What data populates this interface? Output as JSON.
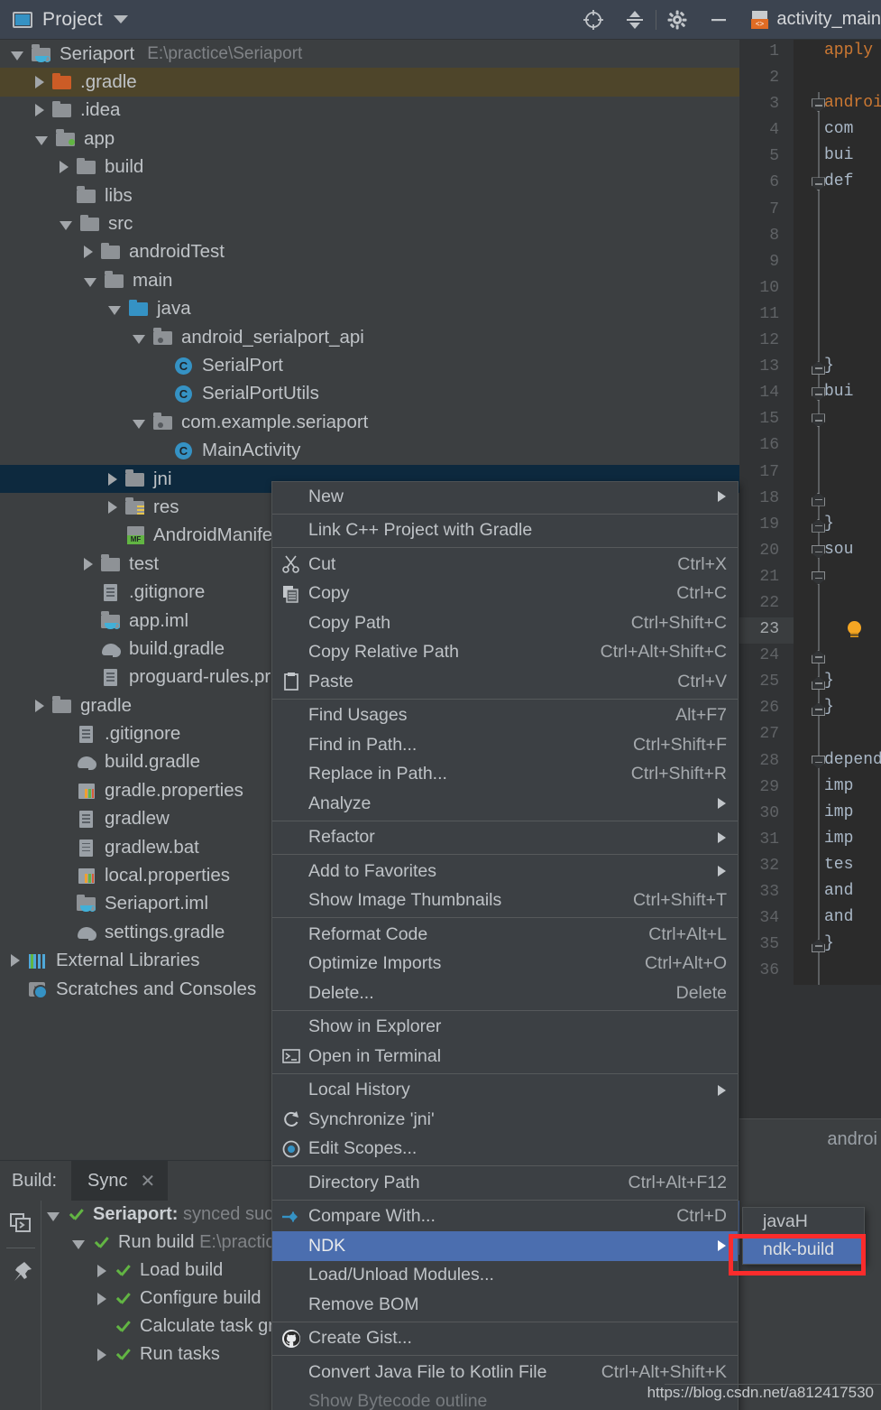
{
  "project_panel": {
    "header": {
      "title": "Project",
      "icon": "project-window-icon",
      "caret_icon": "chevron-down-icon",
      "tools": [
        {
          "name": "locate-icon",
          "label": "Select Opened File"
        },
        {
          "name": "collapse-all-icon",
          "label": "Collapse All"
        },
        {
          "name": "gear-icon",
          "label": "Settings"
        },
        {
          "name": "minimize-icon",
          "label": "Hide"
        }
      ]
    },
    "tree": [
      {
        "label": "Seriaport",
        "path": "E:\\practice\\Seriaport",
        "indent": 0,
        "arrow": "down",
        "icon": "module-folder-icon",
        "state": "normal"
      },
      {
        "label": ".gradle",
        "indent": 1,
        "arrow": "right",
        "icon": "folder-orange-icon",
        "state": "olive"
      },
      {
        "label": ".idea",
        "indent": 1,
        "arrow": "right",
        "icon": "folder-icon",
        "state": "normal"
      },
      {
        "label": "app",
        "indent": 1,
        "arrow": "down",
        "icon": "folder-module-icon",
        "state": "normal"
      },
      {
        "label": "build",
        "indent": 2,
        "arrow": "right",
        "icon": "folder-icon",
        "state": "normal"
      },
      {
        "label": "libs",
        "indent": 2,
        "arrow": "none",
        "icon": "folder-icon",
        "state": "normal"
      },
      {
        "label": "src",
        "indent": 2,
        "arrow": "down",
        "icon": "folder-icon",
        "state": "normal"
      },
      {
        "label": "androidTest",
        "indent": 3,
        "arrow": "right",
        "icon": "folder-icon",
        "state": "normal"
      },
      {
        "label": "main",
        "indent": 3,
        "arrow": "down",
        "icon": "folder-icon",
        "state": "normal"
      },
      {
        "label": "java",
        "indent": 4,
        "arrow": "down",
        "icon": "folder-blue-icon",
        "state": "normal"
      },
      {
        "label": "android_serialport_api",
        "indent": 5,
        "arrow": "down",
        "icon": "package-icon",
        "state": "normal"
      },
      {
        "label": "SerialPort",
        "indent": 6,
        "arrow": "none",
        "icon": "java-class-icon",
        "state": "normal"
      },
      {
        "label": "SerialPortUtils",
        "indent": 6,
        "arrow": "none",
        "icon": "java-class-icon",
        "state": "normal"
      },
      {
        "label": "com.example.seriaport",
        "indent": 5,
        "arrow": "down",
        "icon": "package-icon",
        "state": "normal"
      },
      {
        "label": "MainActivity",
        "indent": 6,
        "arrow": "none",
        "icon": "java-class-icon",
        "state": "normal"
      },
      {
        "label": "jni",
        "indent": 4,
        "arrow": "right",
        "icon": "folder-icon",
        "state": "selected"
      },
      {
        "label": "res",
        "indent": 4,
        "arrow": "right",
        "icon": "folder-res-icon",
        "state": "normal"
      },
      {
        "label": "AndroidManifest.xml",
        "indent": 4,
        "arrow": "none",
        "icon": "manifest-icon",
        "state": "normal"
      },
      {
        "label": "test",
        "indent": 3,
        "arrow": "right",
        "icon": "folder-icon",
        "state": "normal"
      },
      {
        "label": ".gitignore",
        "indent": 3,
        "arrow": "none",
        "icon": "file-icon",
        "state": "normal"
      },
      {
        "label": "app.iml",
        "indent": 3,
        "arrow": "none",
        "icon": "module-folder-icon",
        "state": "normal"
      },
      {
        "label": "build.gradle",
        "indent": 3,
        "arrow": "none",
        "icon": "gradle-icon",
        "state": "normal"
      },
      {
        "label": "proguard-rules.pro",
        "indent": 3,
        "arrow": "none",
        "icon": "file-icon",
        "state": "normal"
      },
      {
        "label": "gradle",
        "indent": 1,
        "arrow": "right",
        "icon": "folder-icon",
        "state": "normal"
      },
      {
        "label": ".gitignore",
        "indent": 2,
        "arrow": "none",
        "icon": "file-icon",
        "state": "normal"
      },
      {
        "label": "build.gradle",
        "indent": 2,
        "arrow": "none",
        "icon": "gradle-icon",
        "state": "normal"
      },
      {
        "label": "gradle.properties",
        "indent": 2,
        "arrow": "none",
        "icon": "properties-icon",
        "state": "normal"
      },
      {
        "label": "gradlew",
        "indent": 2,
        "arrow": "none",
        "icon": "file-icon",
        "state": "normal"
      },
      {
        "label": "gradlew.bat",
        "indent": 2,
        "arrow": "none",
        "icon": "file-icon",
        "state": "normal"
      },
      {
        "label": "local.properties",
        "indent": 2,
        "arrow": "none",
        "icon": "properties-icon",
        "state": "normal"
      },
      {
        "label": "Seriaport.iml",
        "indent": 2,
        "arrow": "none",
        "icon": "module-folder-icon",
        "state": "normal"
      },
      {
        "label": "settings.gradle",
        "indent": 2,
        "arrow": "none",
        "icon": "gradle-icon",
        "state": "normal"
      },
      {
        "label": "External Libraries",
        "indent": 0,
        "arrow": "right",
        "icon": "external-libraries-icon",
        "state": "normal"
      },
      {
        "label": "Scratches and Consoles",
        "indent": 0,
        "arrow": "none",
        "icon": "scratches-icon",
        "state": "normal"
      }
    ]
  },
  "context_menu": {
    "items": [
      {
        "label": "New",
        "key": "",
        "icon": "",
        "submenu": true,
        "sep_after": true
      },
      {
        "label": "Link C++ Project with Gradle",
        "key": "",
        "icon": "",
        "submenu": false,
        "sep_after": true
      },
      {
        "label": "Cut",
        "key": "Ctrl+X",
        "icon": "cut-icon",
        "submenu": false
      },
      {
        "label": "Copy",
        "key": "Ctrl+C",
        "icon": "copy-icon",
        "submenu": false
      },
      {
        "label": "Copy Path",
        "key": "Ctrl+Shift+C",
        "icon": "",
        "submenu": false
      },
      {
        "label": "Copy Relative Path",
        "key": "Ctrl+Alt+Shift+C",
        "icon": "",
        "submenu": false
      },
      {
        "label": "Paste",
        "key": "Ctrl+V",
        "icon": "paste-icon",
        "submenu": false,
        "sep_after": true
      },
      {
        "label": "Find Usages",
        "key": "Alt+F7",
        "icon": "",
        "submenu": false
      },
      {
        "label": "Find in Path...",
        "key": "Ctrl+Shift+F",
        "icon": "",
        "submenu": false
      },
      {
        "label": "Replace in Path...",
        "key": "Ctrl+Shift+R",
        "icon": "",
        "submenu": false
      },
      {
        "label": "Analyze",
        "key": "",
        "icon": "",
        "submenu": true,
        "sep_after": true
      },
      {
        "label": "Refactor",
        "key": "",
        "icon": "",
        "submenu": true,
        "sep_after": true
      },
      {
        "label": "Add to Favorites",
        "key": "",
        "icon": "",
        "submenu": true
      },
      {
        "label": "Show Image Thumbnails",
        "key": "Ctrl+Shift+T",
        "icon": "",
        "submenu": false,
        "sep_after": true
      },
      {
        "label": "Reformat Code",
        "key": "Ctrl+Alt+L",
        "icon": "",
        "submenu": false
      },
      {
        "label": "Optimize Imports",
        "key": "Ctrl+Alt+O",
        "icon": "",
        "submenu": false
      },
      {
        "label": "Delete...",
        "key": "Delete",
        "icon": "",
        "submenu": false,
        "sep_after": true
      },
      {
        "label": "Show in Explorer",
        "key": "",
        "icon": "",
        "submenu": false
      },
      {
        "label": "Open in Terminal",
        "key": "",
        "icon": "terminal-icon",
        "submenu": false,
        "sep_after": true
      },
      {
        "label": "Local History",
        "key": "",
        "icon": "",
        "submenu": true
      },
      {
        "label": "Synchronize 'jni'",
        "key": "",
        "icon": "refresh-icon",
        "submenu": false
      },
      {
        "label": "Edit Scopes...",
        "key": "",
        "icon": "scopes-icon",
        "submenu": false,
        "sep_after": true
      },
      {
        "label": "Directory Path",
        "key": "Ctrl+Alt+F12",
        "icon": "",
        "submenu": false,
        "sep_after": true
      },
      {
        "label": "Compare With...",
        "key": "Ctrl+D",
        "icon": "compare-icon",
        "submenu": false
      },
      {
        "label": "NDK",
        "key": "",
        "icon": "",
        "submenu": true,
        "selected": true
      },
      {
        "label": "Load/Unload Modules...",
        "key": "",
        "icon": "",
        "submenu": false
      },
      {
        "label": "Remove BOM",
        "key": "",
        "icon": "",
        "submenu": false,
        "sep_after": true
      },
      {
        "label": "Create Gist...",
        "key": "",
        "icon": "github-icon",
        "submenu": false,
        "sep_after": true
      },
      {
        "label": "Convert Java File to Kotlin File",
        "key": "Ctrl+Alt+Shift+K",
        "icon": "",
        "submenu": false
      },
      {
        "label": "Show Bytecode outline",
        "key": "",
        "icon": "",
        "submenu": false,
        "disabled": true
      }
    ]
  },
  "ndk_submenu": {
    "items": [
      {
        "label": "javaH",
        "selected": false
      },
      {
        "label": "ndk-build",
        "selected": true
      }
    ],
    "highlight_color": "#fb2c2c"
  },
  "editor": {
    "tab": {
      "title": "activity_main",
      "icon": "android-xml-icon"
    },
    "lines": [
      {
        "n": "1",
        "text": "apply p",
        "fold": "",
        "cur": false
      },
      {
        "n": "2",
        "text": "",
        "fold": "",
        "cur": false
      },
      {
        "n": "3",
        "text": "android",
        "fold": "open",
        "cur": false
      },
      {
        "n": "4",
        "text": "com",
        "fold": "line",
        "cur": false
      },
      {
        "n": "5",
        "text": "bui",
        "fold": "line",
        "cur": false
      },
      {
        "n": "6",
        "text": "def",
        "fold": "open",
        "cur": false
      },
      {
        "n": "7",
        "text": "",
        "fold": "line",
        "cur": false
      },
      {
        "n": "8",
        "text": "",
        "fold": "line",
        "cur": false
      },
      {
        "n": "9",
        "text": "",
        "fold": "line",
        "cur": false
      },
      {
        "n": "10",
        "text": "",
        "fold": "line",
        "cur": false
      },
      {
        "n": "11",
        "text": "",
        "fold": "line",
        "cur": false
      },
      {
        "n": "12",
        "text": "",
        "fold": "line",
        "cur": false
      },
      {
        "n": "13",
        "text": "}",
        "fold": "close",
        "cur": false
      },
      {
        "n": "14",
        "text": "bui",
        "fold": "open",
        "cur": false
      },
      {
        "n": "15",
        "text": "",
        "fold": "open",
        "cur": false
      },
      {
        "n": "16",
        "text": "",
        "fold": "line",
        "cur": false
      },
      {
        "n": "17",
        "text": "",
        "fold": "line",
        "cur": false
      },
      {
        "n": "18",
        "text": "",
        "fold": "close",
        "cur": false
      },
      {
        "n": "19",
        "text": "}",
        "fold": "close",
        "cur": false
      },
      {
        "n": "20",
        "text": "sou",
        "fold": "open",
        "cur": false
      },
      {
        "n": "21",
        "text": "",
        "fold": "open",
        "cur": false
      },
      {
        "n": "22",
        "text": "",
        "fold": "line",
        "cur": false
      },
      {
        "n": "23",
        "text": "",
        "fold": "line",
        "cur": true,
        "bulb": true
      },
      {
        "n": "24",
        "text": "",
        "fold": "close",
        "cur": false
      },
      {
        "n": "25",
        "text": "}",
        "fold": "close",
        "cur": false
      },
      {
        "n": "26",
        "text": "}",
        "fold": "close",
        "cur": false
      },
      {
        "n": "27",
        "text": "",
        "fold": "line",
        "cur": false
      },
      {
        "n": "28",
        "text": "depende",
        "fold": "open",
        "cur": false
      },
      {
        "n": "29",
        "text": "imp",
        "fold": "line",
        "cur": false
      },
      {
        "n": "30",
        "text": "imp",
        "fold": "line",
        "cur": false
      },
      {
        "n": "31",
        "text": "imp",
        "fold": "line",
        "cur": false
      },
      {
        "n": "32",
        "text": "tes",
        "fold": "line",
        "cur": false
      },
      {
        "n": "33",
        "text": "and",
        "fold": "line",
        "cur": false
      },
      {
        "n": "34",
        "text": "and",
        "fold": "line",
        "cur": false
      },
      {
        "n": "35",
        "text": "}",
        "fold": "close",
        "cur": false
      },
      {
        "n": "36",
        "text": "",
        "fold": "line",
        "cur": false
      }
    ],
    "breadcrumb": "androi"
  },
  "build_panel": {
    "label": "Build:",
    "tab": {
      "label": "Sync",
      "close_icon": "close-icon"
    },
    "side_tools": [
      {
        "name": "toggle-tasks-icon"
      },
      {
        "name": "pin-icon"
      }
    ],
    "tree": [
      {
        "label": "Seriaport:",
        "suffix": "synced succ",
        "indent": 0,
        "arrow": "down",
        "bold": true
      },
      {
        "label": "Run build",
        "suffix": "E:\\practic",
        "indent": 1,
        "arrow": "down",
        "bold": false
      },
      {
        "label": "Load build",
        "suffix": "",
        "indent": 2,
        "arrow": "right",
        "bold": false
      },
      {
        "label": "Configure build",
        "suffix": "",
        "indent": 2,
        "arrow": "right",
        "bold": false
      },
      {
        "label": "Calculate task gr",
        "suffix": "",
        "indent": 2,
        "arrow": "none",
        "bold": false
      },
      {
        "label": "Run tasks",
        "suffix": "",
        "indent": 2,
        "arrow": "right",
        "bold": false
      }
    ]
  },
  "watermark": {
    "text": "https://blog.csdn.net/a812417530"
  },
  "colors": {
    "bg": "#3c3f41",
    "header_bg": "#3c4450",
    "menu_bg": "#3c4044",
    "menu_selected": "#4b6eaf",
    "tree_selected": "#0d293e",
    "tree_olive": "#4e452a",
    "editor_bg": "#2b2b2b",
    "gutter_bg": "#313335",
    "accent_blue": "#3592c4",
    "accent_green": "#62b543",
    "accent_orange": "#cc5c26",
    "highlight_red": "#fb2c2c",
    "text": "#bfc3c7"
  }
}
